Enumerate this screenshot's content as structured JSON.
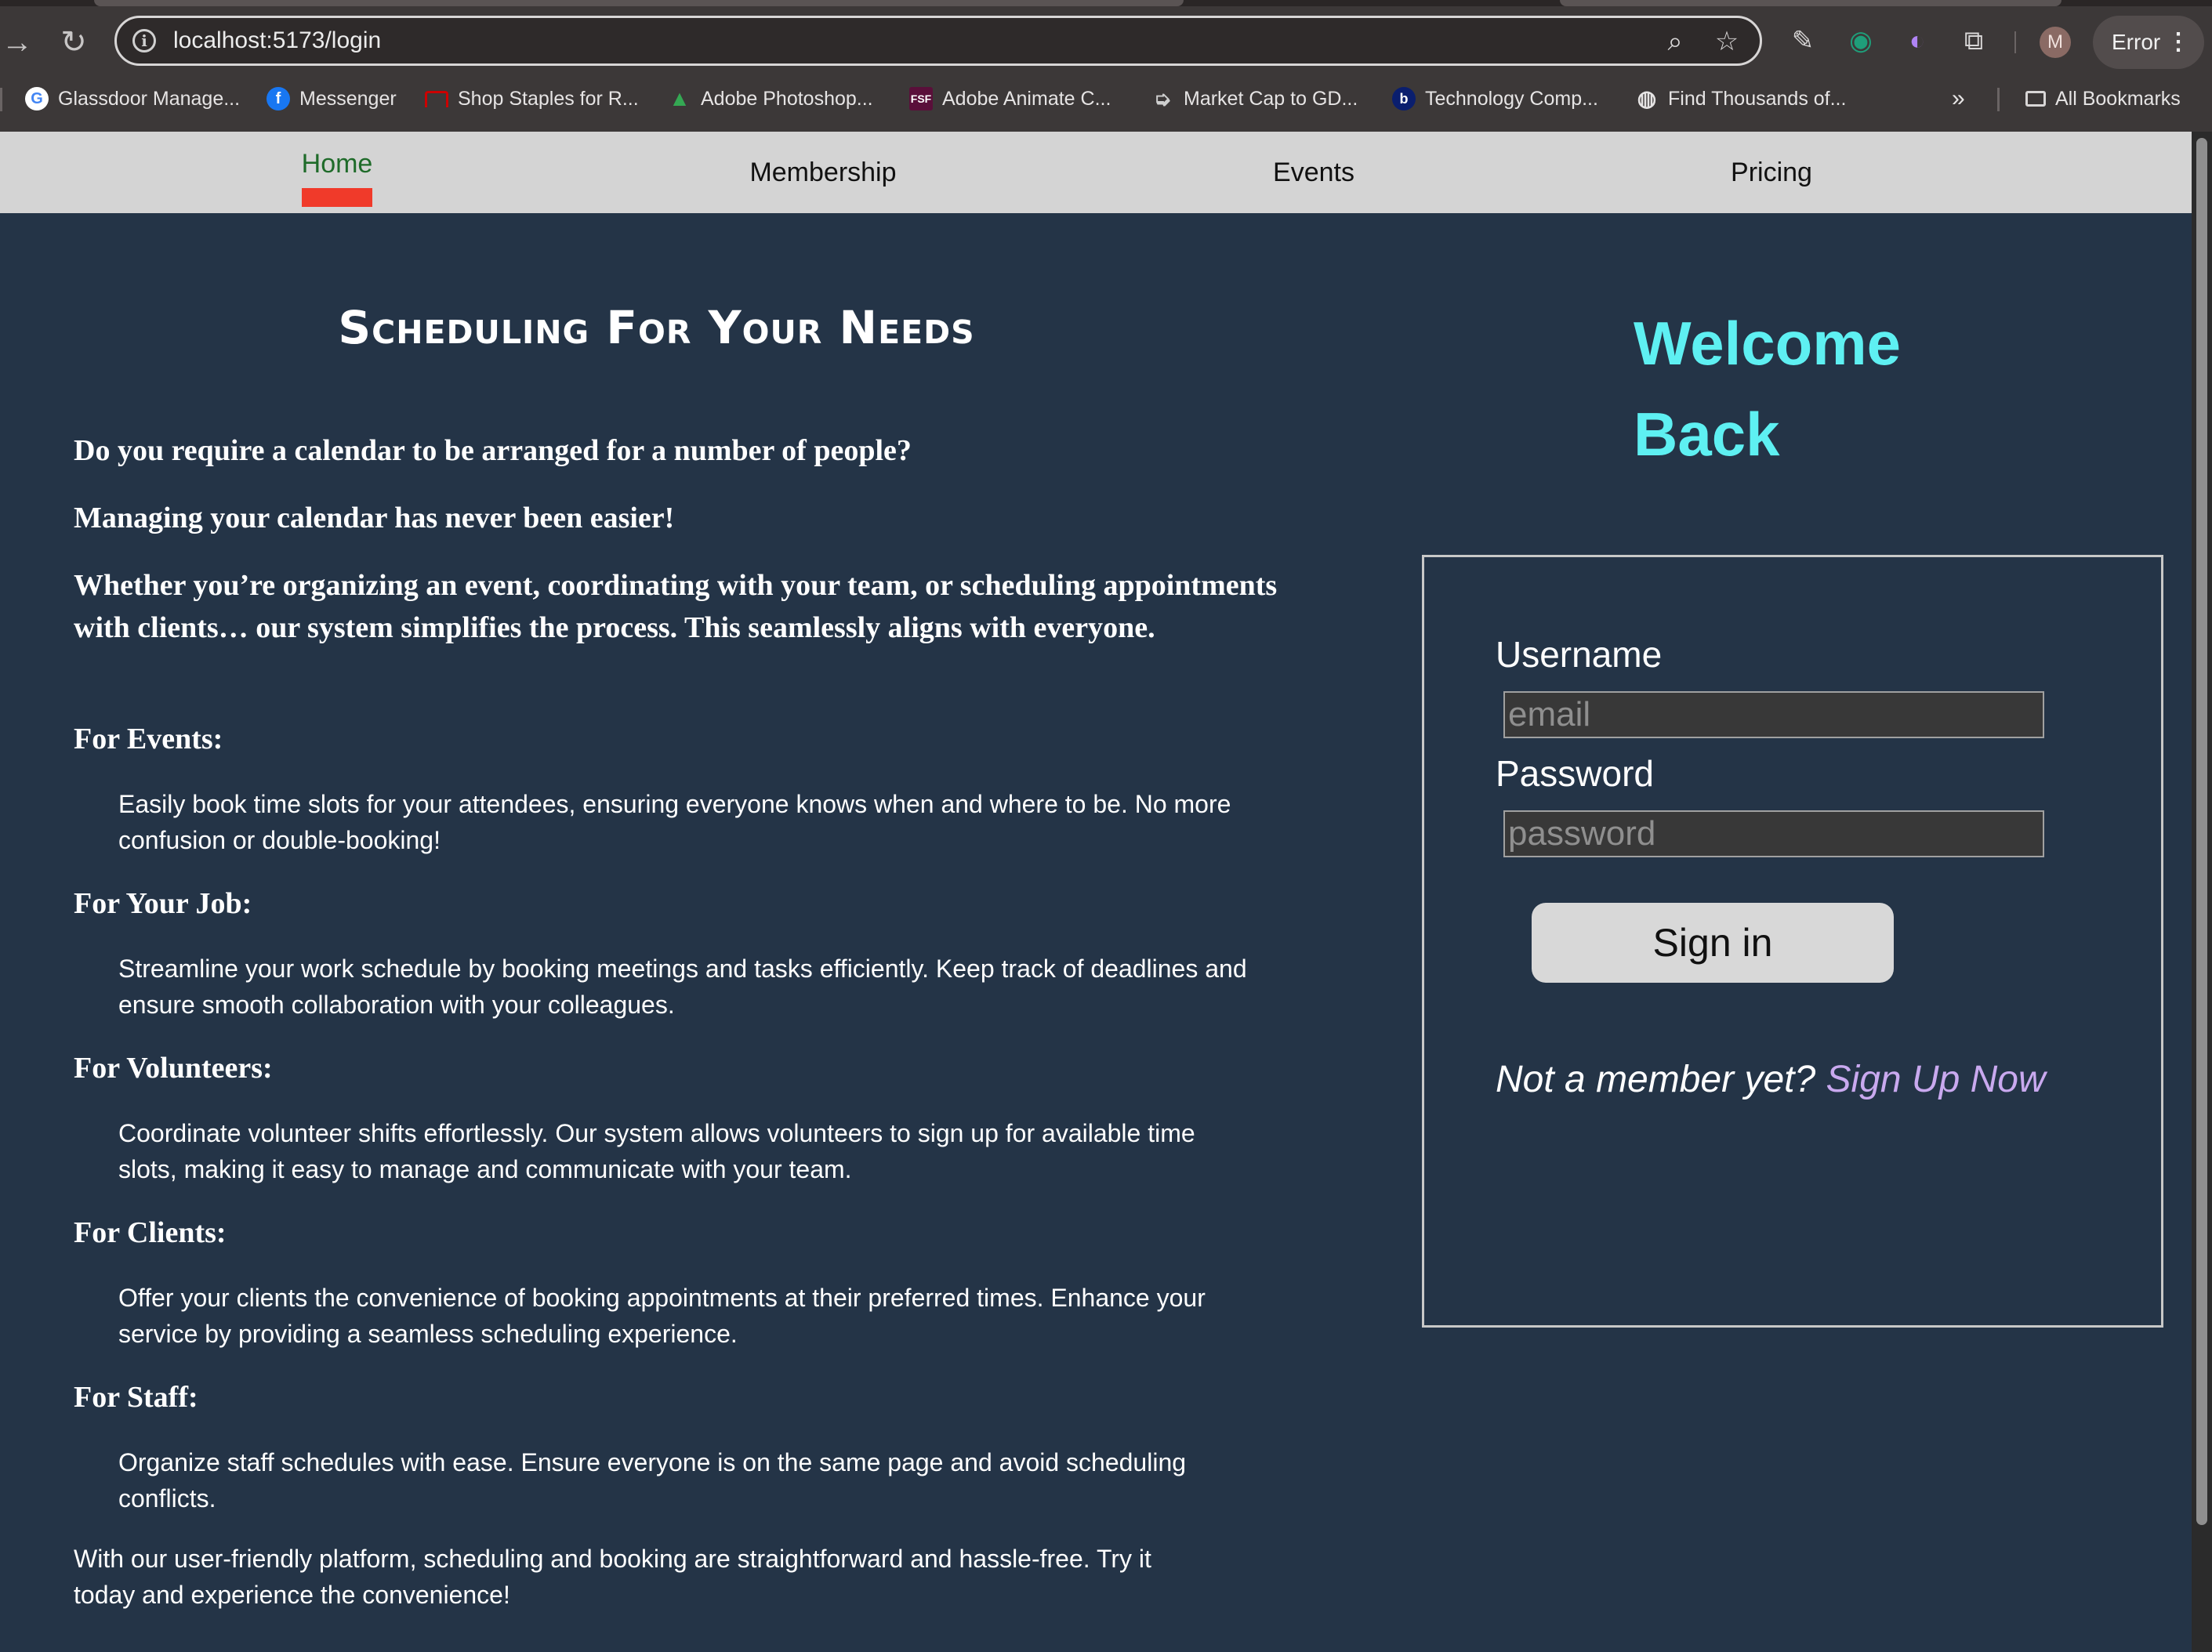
{
  "browser": {
    "url": "localhost:5173/login",
    "profile_initial": "M",
    "error_label": "Error",
    "bookmarks": [
      {
        "label": "Glassdoor Manage...",
        "icon": "google-icon",
        "color": "#ffffff"
      },
      {
        "label": "Messenger",
        "icon": "facebook-icon",
        "color": "#1877f2"
      },
      {
        "label": "Shop Staples for R...",
        "icon": "staples-icon",
        "color": "#cc0000"
      },
      {
        "label": "Adobe Photoshop...",
        "icon": "google-drive-icon",
        "color": "#34a853"
      },
      {
        "label": "Adobe Animate C...",
        "icon": "fsf-icon",
        "color": "#5a0f3a"
      },
      {
        "label": "Market Cap to GD...",
        "icon": "market-icon",
        "color": "#cfcfcf"
      },
      {
        "label": "Technology Comp...",
        "icon": "b-icon",
        "color": "#0a1e6e"
      },
      {
        "label": "Find Thousands of...",
        "icon": "globe-icon",
        "color": "#e6e4e4"
      }
    ],
    "all_bookmarks": "All Bookmarks"
  },
  "nav": {
    "items": [
      {
        "label": "Home",
        "active": true
      },
      {
        "label": "Membership",
        "active": false
      },
      {
        "label": "Events",
        "active": false
      },
      {
        "label": "Pricing",
        "active": false
      }
    ]
  },
  "main": {
    "title": "Scheduling For Your Needs",
    "intro": [
      "Do you require a calendar to be arranged for a number of people?",
      "Managing your calendar has never been easier!",
      "Whether you’re organizing an event, coordinating with your team, or scheduling appointments with clients… our system simplifies the process. This seamlessly aligns with everyone."
    ],
    "sections": [
      {
        "heading": "For Events:",
        "text": "Easily book time slots for your attendees, ensuring everyone knows when and where to be. No more confusion or double-booking!"
      },
      {
        "heading": "For Your Job:",
        "text": "Streamline your work schedule by booking meetings and tasks efficiently. Keep track of deadlines and ensure smooth collaboration with your colleagues."
      },
      {
        "heading": "For Volunteers:",
        "text": "Coordinate volunteer shifts effortlessly. Our system allows volunteers to sign up for available time slots, making it easy to manage and communicate with your team."
      },
      {
        "heading": "For Clients:",
        "text": "Offer your clients the convenience of booking appointments at their preferred times. Enhance your service by providing a seamless scheduling experience."
      },
      {
        "heading": "For Staff:",
        "text": "Organize staff schedules with ease. Ensure everyone is on the same page and avoid scheduling conflicts."
      }
    ],
    "closing": "With our user-friendly platform, scheduling and booking are straightforward and hassle-free. Try it today and experience the convenience!"
  },
  "login": {
    "welcome_line1": "Welcome",
    "welcome_line2": "Back",
    "username_label": "Username",
    "username_placeholder": "email",
    "password_label": "Password",
    "password_placeholder": "password",
    "submit_label": "Sign in",
    "not_member_text": "Not a member yet?",
    "signup_link": "Sign Up Now"
  },
  "colors": {
    "page_bg": "#243447",
    "nav_bg": "#d4d4d4",
    "active_nav_text": "#1f6b2a",
    "active_nav_underline": "#f03a2a",
    "welcome_text": "#5ef0f2",
    "signup_link": "#c9a9ef"
  }
}
